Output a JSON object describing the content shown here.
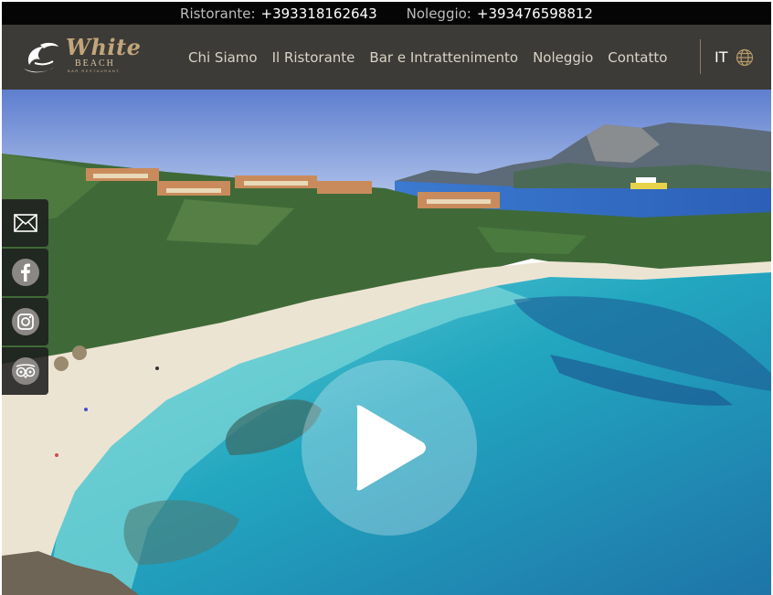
{
  "topbar": {
    "ristorante_label": "Ristorante:",
    "ristorante_phone": "+393318162643",
    "noleggio_label": "Noleggio:",
    "noleggio_phone": "+393476598812"
  },
  "logo": {
    "name": "White",
    "sub": "BEACH",
    "tagline": "BAR RESTAURANT"
  },
  "nav": {
    "items": [
      {
        "label": "Chi Siamo"
      },
      {
        "label": "Il Ristorante"
      },
      {
        "label": "Bar e Intrattenimento"
      },
      {
        "label": "Noleggio"
      },
      {
        "label": "Contatto"
      }
    ]
  },
  "language": {
    "current": "IT",
    "icon": "globe-icon"
  },
  "social": {
    "icons": [
      "email-icon",
      "facebook-icon",
      "instagram-icon",
      "tripadvisor-icon"
    ]
  },
  "hero": {
    "play_icon": "play-icon"
  },
  "colors": {
    "topbar_bg": "#050505",
    "header_bg": "#3d3b37",
    "logo_gold": "#c2a57a",
    "nav_text": "#d9d3c7",
    "sea": "#1f8fa6"
  }
}
